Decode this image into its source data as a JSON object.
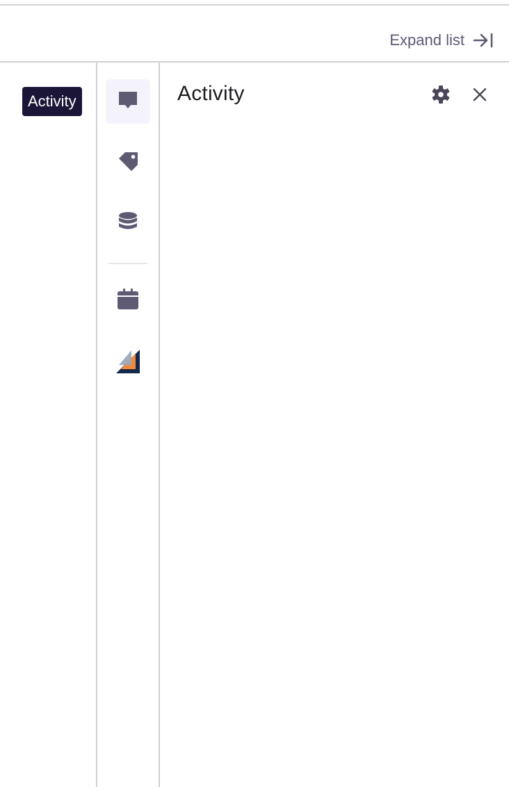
{
  "header": {
    "expand_label": "Expand list",
    "expand_icon": "arrow-right-to-bar-icon"
  },
  "tooltip": {
    "text": "Activity"
  },
  "rail": {
    "items": [
      {
        "name": "activity",
        "icon": "comment-icon",
        "active": true
      },
      {
        "name": "tags",
        "icon": "tag-icon",
        "active": false
      },
      {
        "name": "database",
        "icon": "database-icon",
        "active": false
      },
      {
        "name": "calendar",
        "icon": "calendar-icon",
        "active": false
      },
      {
        "name": "integration",
        "icon": "integration-logo-icon",
        "active": false
      }
    ]
  },
  "panel": {
    "title": "Activity",
    "settings_icon": "gear-icon",
    "close_icon": "close-icon"
  },
  "colors": {
    "icon": "#5e5a72",
    "tooltip_bg": "#1b1637",
    "active_bg": "#f4f3fb",
    "border": "#d0d0d4",
    "title": "#1d1d21"
  }
}
